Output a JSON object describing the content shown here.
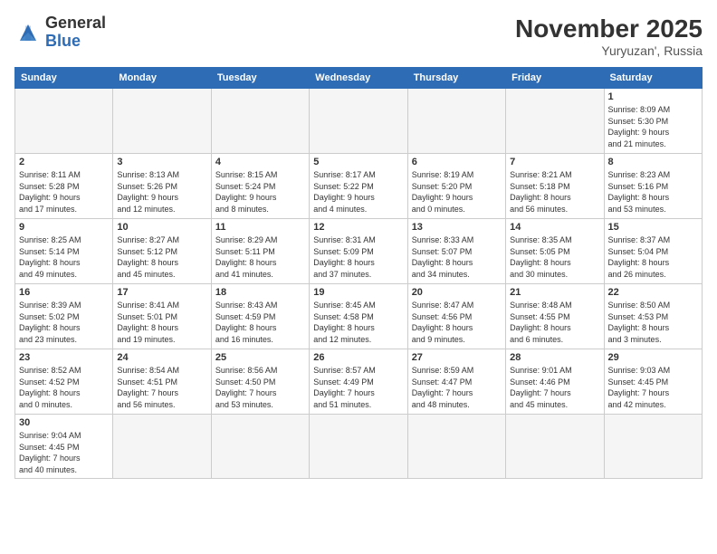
{
  "header": {
    "logo_general": "General",
    "logo_blue": "Blue",
    "month_title": "November 2025",
    "subtitle": "Yuryuzan', Russia"
  },
  "days_of_week": [
    "Sunday",
    "Monday",
    "Tuesday",
    "Wednesday",
    "Thursday",
    "Friday",
    "Saturday"
  ],
  "weeks": [
    [
      {
        "day": "",
        "info": ""
      },
      {
        "day": "",
        "info": ""
      },
      {
        "day": "",
        "info": ""
      },
      {
        "day": "",
        "info": ""
      },
      {
        "day": "",
        "info": ""
      },
      {
        "day": "",
        "info": ""
      },
      {
        "day": "1",
        "info": "Sunrise: 8:09 AM\nSunset: 5:30 PM\nDaylight: 9 hours\nand 21 minutes."
      }
    ],
    [
      {
        "day": "2",
        "info": "Sunrise: 8:11 AM\nSunset: 5:28 PM\nDaylight: 9 hours\nand 17 minutes."
      },
      {
        "day": "3",
        "info": "Sunrise: 8:13 AM\nSunset: 5:26 PM\nDaylight: 9 hours\nand 12 minutes."
      },
      {
        "day": "4",
        "info": "Sunrise: 8:15 AM\nSunset: 5:24 PM\nDaylight: 9 hours\nand 8 minutes."
      },
      {
        "day": "5",
        "info": "Sunrise: 8:17 AM\nSunset: 5:22 PM\nDaylight: 9 hours\nand 4 minutes."
      },
      {
        "day": "6",
        "info": "Sunrise: 8:19 AM\nSunset: 5:20 PM\nDaylight: 9 hours\nand 0 minutes."
      },
      {
        "day": "7",
        "info": "Sunrise: 8:21 AM\nSunset: 5:18 PM\nDaylight: 8 hours\nand 56 minutes."
      },
      {
        "day": "8",
        "info": "Sunrise: 8:23 AM\nSunset: 5:16 PM\nDaylight: 8 hours\nand 53 minutes."
      }
    ],
    [
      {
        "day": "9",
        "info": "Sunrise: 8:25 AM\nSunset: 5:14 PM\nDaylight: 8 hours\nand 49 minutes."
      },
      {
        "day": "10",
        "info": "Sunrise: 8:27 AM\nSunset: 5:12 PM\nDaylight: 8 hours\nand 45 minutes."
      },
      {
        "day": "11",
        "info": "Sunrise: 8:29 AM\nSunset: 5:11 PM\nDaylight: 8 hours\nand 41 minutes."
      },
      {
        "day": "12",
        "info": "Sunrise: 8:31 AM\nSunset: 5:09 PM\nDaylight: 8 hours\nand 37 minutes."
      },
      {
        "day": "13",
        "info": "Sunrise: 8:33 AM\nSunset: 5:07 PM\nDaylight: 8 hours\nand 34 minutes."
      },
      {
        "day": "14",
        "info": "Sunrise: 8:35 AM\nSunset: 5:05 PM\nDaylight: 8 hours\nand 30 minutes."
      },
      {
        "day": "15",
        "info": "Sunrise: 8:37 AM\nSunset: 5:04 PM\nDaylight: 8 hours\nand 26 minutes."
      }
    ],
    [
      {
        "day": "16",
        "info": "Sunrise: 8:39 AM\nSunset: 5:02 PM\nDaylight: 8 hours\nand 23 minutes."
      },
      {
        "day": "17",
        "info": "Sunrise: 8:41 AM\nSunset: 5:01 PM\nDaylight: 8 hours\nand 19 minutes."
      },
      {
        "day": "18",
        "info": "Sunrise: 8:43 AM\nSunset: 4:59 PM\nDaylight: 8 hours\nand 16 minutes."
      },
      {
        "day": "19",
        "info": "Sunrise: 8:45 AM\nSunset: 4:58 PM\nDaylight: 8 hours\nand 12 minutes."
      },
      {
        "day": "20",
        "info": "Sunrise: 8:47 AM\nSunset: 4:56 PM\nDaylight: 8 hours\nand 9 minutes."
      },
      {
        "day": "21",
        "info": "Sunrise: 8:48 AM\nSunset: 4:55 PM\nDaylight: 8 hours\nand 6 minutes."
      },
      {
        "day": "22",
        "info": "Sunrise: 8:50 AM\nSunset: 4:53 PM\nDaylight: 8 hours\nand 3 minutes."
      }
    ],
    [
      {
        "day": "23",
        "info": "Sunrise: 8:52 AM\nSunset: 4:52 PM\nDaylight: 8 hours\nand 0 minutes."
      },
      {
        "day": "24",
        "info": "Sunrise: 8:54 AM\nSunset: 4:51 PM\nDaylight: 7 hours\nand 56 minutes."
      },
      {
        "day": "25",
        "info": "Sunrise: 8:56 AM\nSunset: 4:50 PM\nDaylight: 7 hours\nand 53 minutes."
      },
      {
        "day": "26",
        "info": "Sunrise: 8:57 AM\nSunset: 4:49 PM\nDaylight: 7 hours\nand 51 minutes."
      },
      {
        "day": "27",
        "info": "Sunrise: 8:59 AM\nSunset: 4:47 PM\nDaylight: 7 hours\nand 48 minutes."
      },
      {
        "day": "28",
        "info": "Sunrise: 9:01 AM\nSunset: 4:46 PM\nDaylight: 7 hours\nand 45 minutes."
      },
      {
        "day": "29",
        "info": "Sunrise: 9:03 AM\nSunset: 4:45 PM\nDaylight: 7 hours\nand 42 minutes."
      }
    ],
    [
      {
        "day": "30",
        "info": "Sunrise: 9:04 AM\nSunset: 4:45 PM\nDaylight: 7 hours\nand 40 minutes."
      },
      {
        "day": "",
        "info": ""
      },
      {
        "day": "",
        "info": ""
      },
      {
        "day": "",
        "info": ""
      },
      {
        "day": "",
        "info": ""
      },
      {
        "day": "",
        "info": ""
      },
      {
        "day": "",
        "info": ""
      }
    ]
  ]
}
